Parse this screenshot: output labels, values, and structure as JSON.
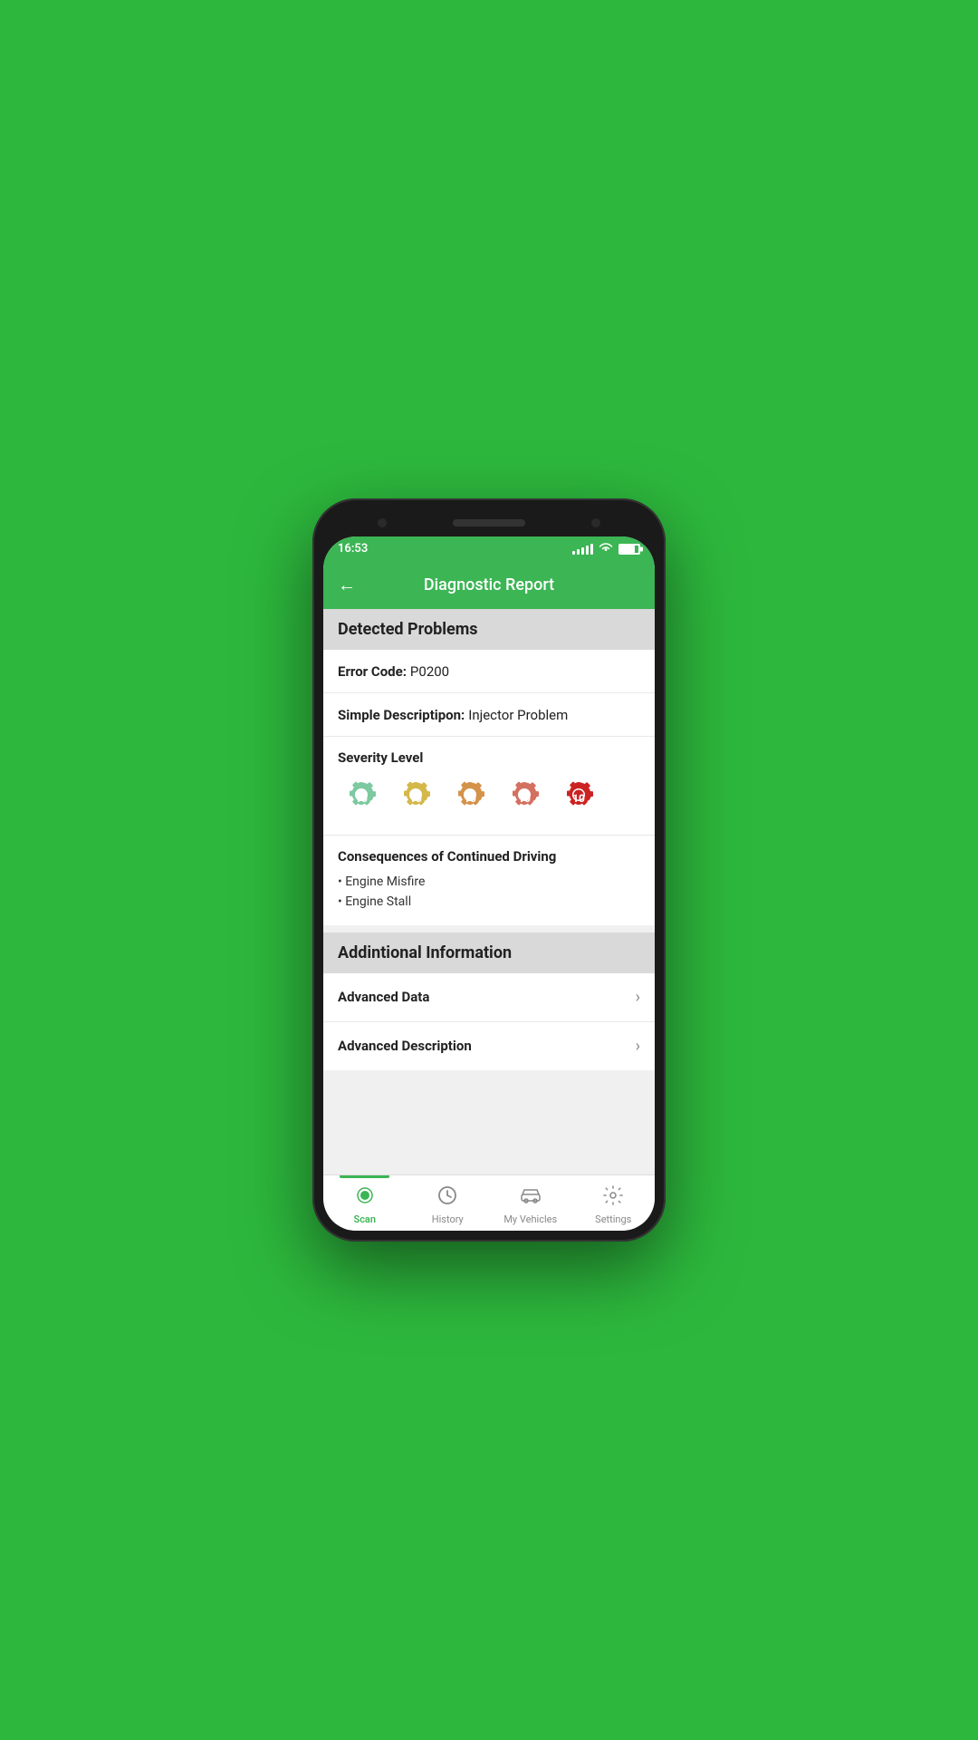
{
  "statusBar": {
    "time": "16:53"
  },
  "header": {
    "title": "Diagnostic Report",
    "backLabel": "←"
  },
  "detectedProblems": {
    "sectionTitle": "Detected Problems",
    "errorCodeLabel": "Error Code:",
    "errorCodeValue": "P0200",
    "simpleDescLabel": "Simple Descriptipon:",
    "simpleDescValue": "Injector Problem",
    "severityLabel": "Severity Level",
    "severityGears": [
      {
        "color": "#7dc9a0",
        "level": 1
      },
      {
        "color": "#d4b84a",
        "level": 2
      },
      {
        "color": "#d4924a",
        "level": 3
      },
      {
        "color": "#d47060",
        "level": 4
      },
      {
        "color": "#cc2222",
        "level": 5
      }
    ],
    "consequencesTitle": "Consequences of Continued Driving",
    "consequences": [
      "Engine Misfire",
      "Engine Stall"
    ]
  },
  "additionalInfo": {
    "sectionTitle": "Addintional Information",
    "items": [
      {
        "label": "Advanced Data",
        "id": "advanced-data"
      },
      {
        "label": "Advanced Description",
        "id": "advanced-description"
      }
    ]
  },
  "bottomNav": {
    "items": [
      {
        "label": "Scan",
        "icon": "⊙",
        "id": "scan",
        "active": true
      },
      {
        "label": "History",
        "icon": "🕐",
        "id": "history",
        "active": false
      },
      {
        "label": "My Vehicles",
        "icon": "🚗",
        "id": "my-vehicles",
        "active": false
      },
      {
        "label": "Settings",
        "icon": "⚙",
        "id": "settings",
        "active": false
      }
    ]
  }
}
